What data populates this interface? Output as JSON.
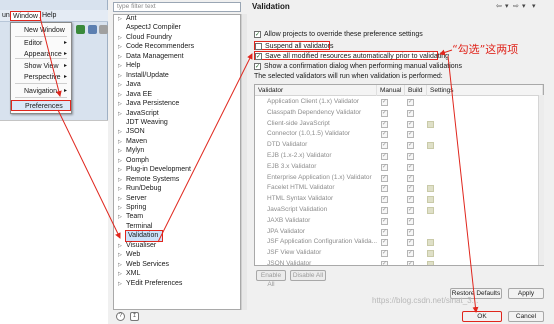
{
  "menubar": {
    "partial": "un",
    "window": "Window",
    "help": "Help"
  },
  "dropdown": {
    "items": [
      {
        "label": "New Window",
        "submenu": false
      },
      {
        "label": "Editor",
        "submenu": true
      },
      {
        "label": "Appearance",
        "submenu": true
      },
      {
        "label": "Show View",
        "submenu": true
      },
      {
        "label": "Perspective",
        "submenu": true
      },
      {
        "label": "Navigation",
        "submenu": true
      },
      {
        "label": "Preferences",
        "submenu": false
      }
    ]
  },
  "filter": {
    "placeholder": "type filter text"
  },
  "tree": {
    "items": [
      {
        "label": "Ant",
        "expandable": true
      },
      {
        "label": "AspectJ Compiler",
        "expandable": false
      },
      {
        "label": "Cloud Foundry",
        "expandable": true
      },
      {
        "label": "Code Recommenders",
        "expandable": true
      },
      {
        "label": "Data Management",
        "expandable": true
      },
      {
        "label": "Help",
        "expandable": true
      },
      {
        "label": "Install/Update",
        "expandable": true
      },
      {
        "label": "Java",
        "expandable": true
      },
      {
        "label": "Java EE",
        "expandable": true
      },
      {
        "label": "Java Persistence",
        "expandable": true
      },
      {
        "label": "JavaScript",
        "expandable": true
      },
      {
        "label": "JDT Weaving",
        "expandable": false
      },
      {
        "label": "JSON",
        "expandable": true
      },
      {
        "label": "Maven",
        "expandable": true
      },
      {
        "label": "Mylyn",
        "expandable": true
      },
      {
        "label": "Oomph",
        "expandable": true
      },
      {
        "label": "Plug-in Development",
        "expandable": true
      },
      {
        "label": "Remote Systems",
        "expandable": true
      },
      {
        "label": "Run/Debug",
        "expandable": true
      },
      {
        "label": "Server",
        "expandable": true
      },
      {
        "label": "Spring",
        "expandable": true
      },
      {
        "label": "Team",
        "expandable": true
      },
      {
        "label": "Terminal",
        "expandable": false
      },
      {
        "label": "Validation",
        "expandable": false
      },
      {
        "label": "Visualiser",
        "expandable": true
      },
      {
        "label": "Web",
        "expandable": true
      },
      {
        "label": "Web Services",
        "expandable": true
      },
      {
        "label": "XML",
        "expandable": true
      },
      {
        "label": "YEdit Preferences",
        "expandable": true
      }
    ]
  },
  "page": {
    "title": "Validation",
    "options": [
      {
        "label": "Allow projects to override these preference settings",
        "checked": true
      },
      {
        "label": "Suspend all validators",
        "checked": false
      },
      {
        "label": "Save all modified resources automatically prior to validating",
        "checked": true
      },
      {
        "label": "Show a confirmation dialog when performing manual validations",
        "checked": true
      }
    ],
    "annotation": "“勾选”这两项",
    "run_text": "The selected validators will run when validation is performed:",
    "table": {
      "headers": [
        "Validator",
        "Manual",
        "Build",
        "Settings"
      ],
      "rows": [
        {
          "name": "Application Client (1.x) Validator",
          "manual": true,
          "build": true,
          "settings": false
        },
        {
          "name": "Classpath Dependency Validator",
          "manual": true,
          "build": true,
          "settings": false
        },
        {
          "name": "Client-side JavaScript",
          "manual": true,
          "build": true,
          "settings": true
        },
        {
          "name": "Connector (1.0,1.5) Validator",
          "manual": true,
          "build": true,
          "settings": false
        },
        {
          "name": "DTD Validator",
          "manual": true,
          "build": true,
          "settings": true
        },
        {
          "name": "EJB (1.x-2.x) Validator",
          "manual": true,
          "build": true,
          "settings": false
        },
        {
          "name": "EJB 3.x Validator",
          "manual": true,
          "build": true,
          "settings": false
        },
        {
          "name": "Enterprise Application (1.x) Validator",
          "manual": true,
          "build": true,
          "settings": false
        },
        {
          "name": "Facelet HTML Validator",
          "manual": true,
          "build": true,
          "settings": true
        },
        {
          "name": "HTML Syntax Validator",
          "manual": true,
          "build": true,
          "settings": true
        },
        {
          "name": "JavaScript Validation",
          "manual": true,
          "build": true,
          "settings": true
        },
        {
          "name": "JAXB Validator",
          "manual": true,
          "build": true,
          "settings": false
        },
        {
          "name": "JPA Validator",
          "manual": true,
          "build": true,
          "settings": false
        },
        {
          "name": "JSF Application Configuration Valida...",
          "manual": true,
          "build": true,
          "settings": true
        },
        {
          "name": "JSF View Validator",
          "manual": true,
          "build": true,
          "settings": true
        },
        {
          "name": "JSON Validator",
          "manual": true,
          "build": true,
          "settings": true
        }
      ]
    },
    "buttons": {
      "enable_all": "Enable All",
      "disable_all": "Disable All",
      "restore_defaults": "Restore Defaults",
      "apply": "Apply",
      "ok": "OK",
      "cancel": "Cancel"
    },
    "watermark": "https://blog.csdn.net/sinat_3..."
  },
  "colors": {
    "annotation_red": "#e0261d",
    "selection": "#cde2fb"
  }
}
